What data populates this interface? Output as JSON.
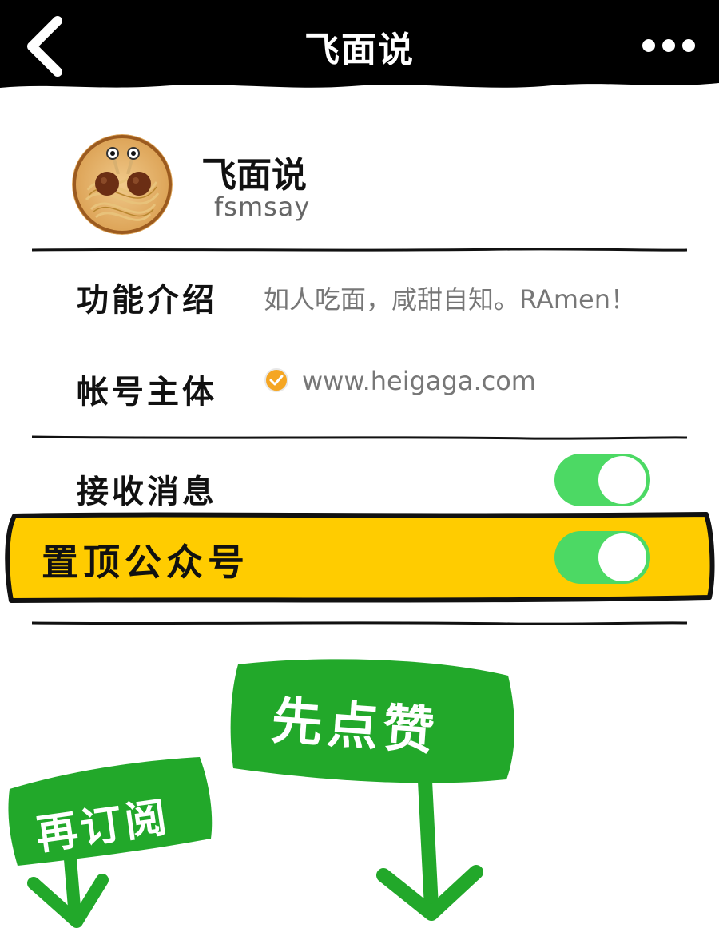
{
  "topbar": {
    "title": "飞面说",
    "back_icon": "chevron-left-icon",
    "more_icon": "ellipsis-icon"
  },
  "profile": {
    "name": "飞面说",
    "account_id": "fsmsay"
  },
  "info_rows": [
    {
      "label": "功能介绍",
      "value": "如人吃面，咸甜自知。RAmen！"
    },
    {
      "label": "帐号主体",
      "value": "www.heigaga.com"
    }
  ],
  "settings": {
    "receive_messages": {
      "label": "接收消息",
      "on": true
    },
    "pin_account": {
      "label": "置顶公众号",
      "on": true
    }
  },
  "callouts": {
    "like": "先点赞",
    "subscribe": "再订阅"
  },
  "colors": {
    "bar": "#000000",
    "toggle_on": "#4cd964",
    "highlight": "#ffcc00",
    "sign_green": "#22a82a",
    "verified": "#f5a623"
  }
}
